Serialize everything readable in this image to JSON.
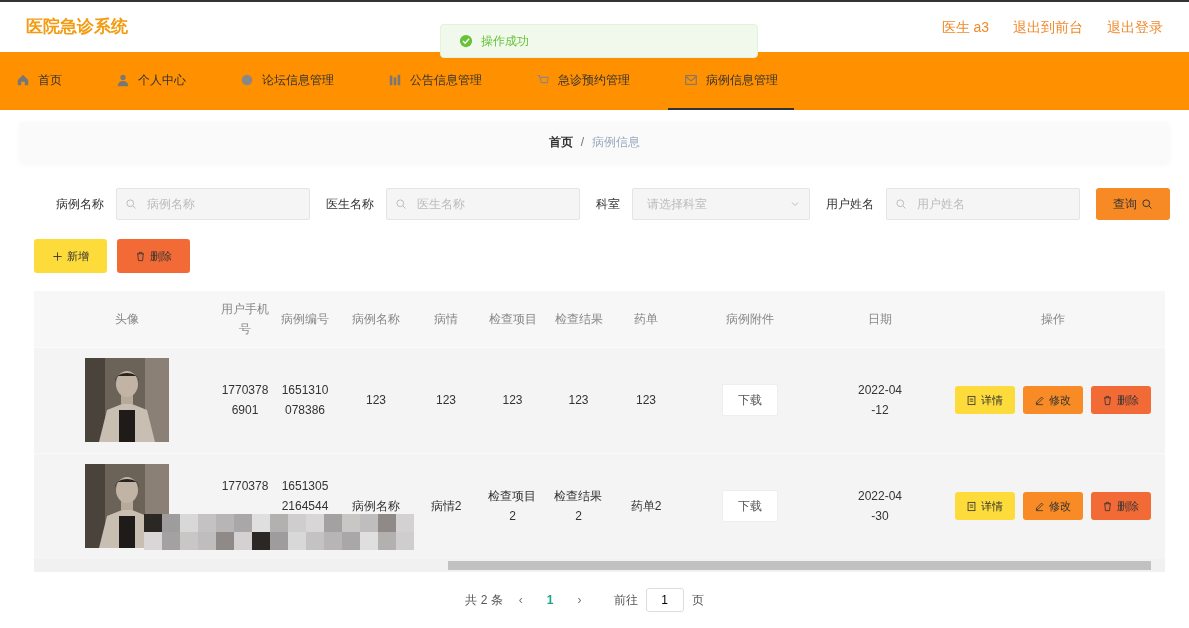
{
  "header": {
    "title": "医院急诊系统",
    "links": [
      "医生 a3",
      "退出到前台",
      "退出登录"
    ]
  },
  "toast": {
    "text": "操作成功"
  },
  "nav": [
    {
      "label": "首页",
      "selected": false
    },
    {
      "label": "个人中心",
      "selected": false
    },
    {
      "label": "论坛信息管理",
      "selected": false
    },
    {
      "label": "公告信息管理",
      "selected": false
    },
    {
      "label": "急诊预约管理",
      "selected": false
    },
    {
      "label": "病例信息管理",
      "selected": true
    }
  ],
  "breadcrumb": {
    "items": [
      "首页",
      "病例信息"
    ],
    "separator": "/"
  },
  "filters": [
    {
      "kind": "text",
      "label": "病例名称",
      "placeholder": "病例名称"
    },
    {
      "kind": "text",
      "label": "医生名称",
      "placeholder": "医生名称"
    },
    {
      "kind": "select",
      "label": "科室",
      "placeholder": "请选择科室"
    },
    {
      "kind": "text",
      "label": "用户姓名",
      "placeholder": "用户姓名"
    }
  ],
  "search_button": "查询",
  "actions": [
    {
      "kind": "add",
      "label": "新增"
    },
    {
      "kind": "delete",
      "label": "删除"
    }
  ],
  "table": {
    "columns": [
      "头像",
      "用户手机号",
      "病例编号",
      "病例名称",
      "病情",
      "检查项目",
      "检查结果",
      "药单",
      "病例附件",
      "日期",
      "操作"
    ],
    "rows": [
      {
        "cells": [
          {
            "kind": "picture"
          },
          "17703786901",
          "1651310078386",
          "123",
          "123",
          "123",
          "123",
          "123",
          {
            "kind": "button",
            "label": "下载"
          },
          "2022-04-12",
          {
            "kind": "actions",
            "buttons": [
              {
                "kind": "detail",
                "label": "详情"
              },
              {
                "kind": "edit",
                "label": "修改"
              },
              {
                "kind": "delete",
                "label": "删除"
              }
            ]
          }
        ],
        "redacted": false
      },
      {
        "cells": [
          {
            "kind": "picture"
          },
          "1770378",
          "16513052164544",
          "病例名称",
          "病情2",
          "检查项目2",
          "检查结果2",
          "药单2",
          {
            "kind": "button",
            "label": "下载"
          },
          "2022-04-30",
          {
            "kind": "actions",
            "buttons": [
              {
                "kind": "detail",
                "label": "详情"
              },
              {
                "kind": "edit",
                "label": "修改"
              },
              {
                "kind": "delete",
                "label": "删除"
              }
            ]
          }
        ],
        "redacted": true
      }
    ]
  },
  "pagination": {
    "total": "共 2 条",
    "prev": "‹",
    "pages": [
      {
        "label": "1",
        "selected": true
      }
    ],
    "next": "›",
    "goto": "前往",
    "page_input": "1",
    "page_suffix": "页"
  }
}
